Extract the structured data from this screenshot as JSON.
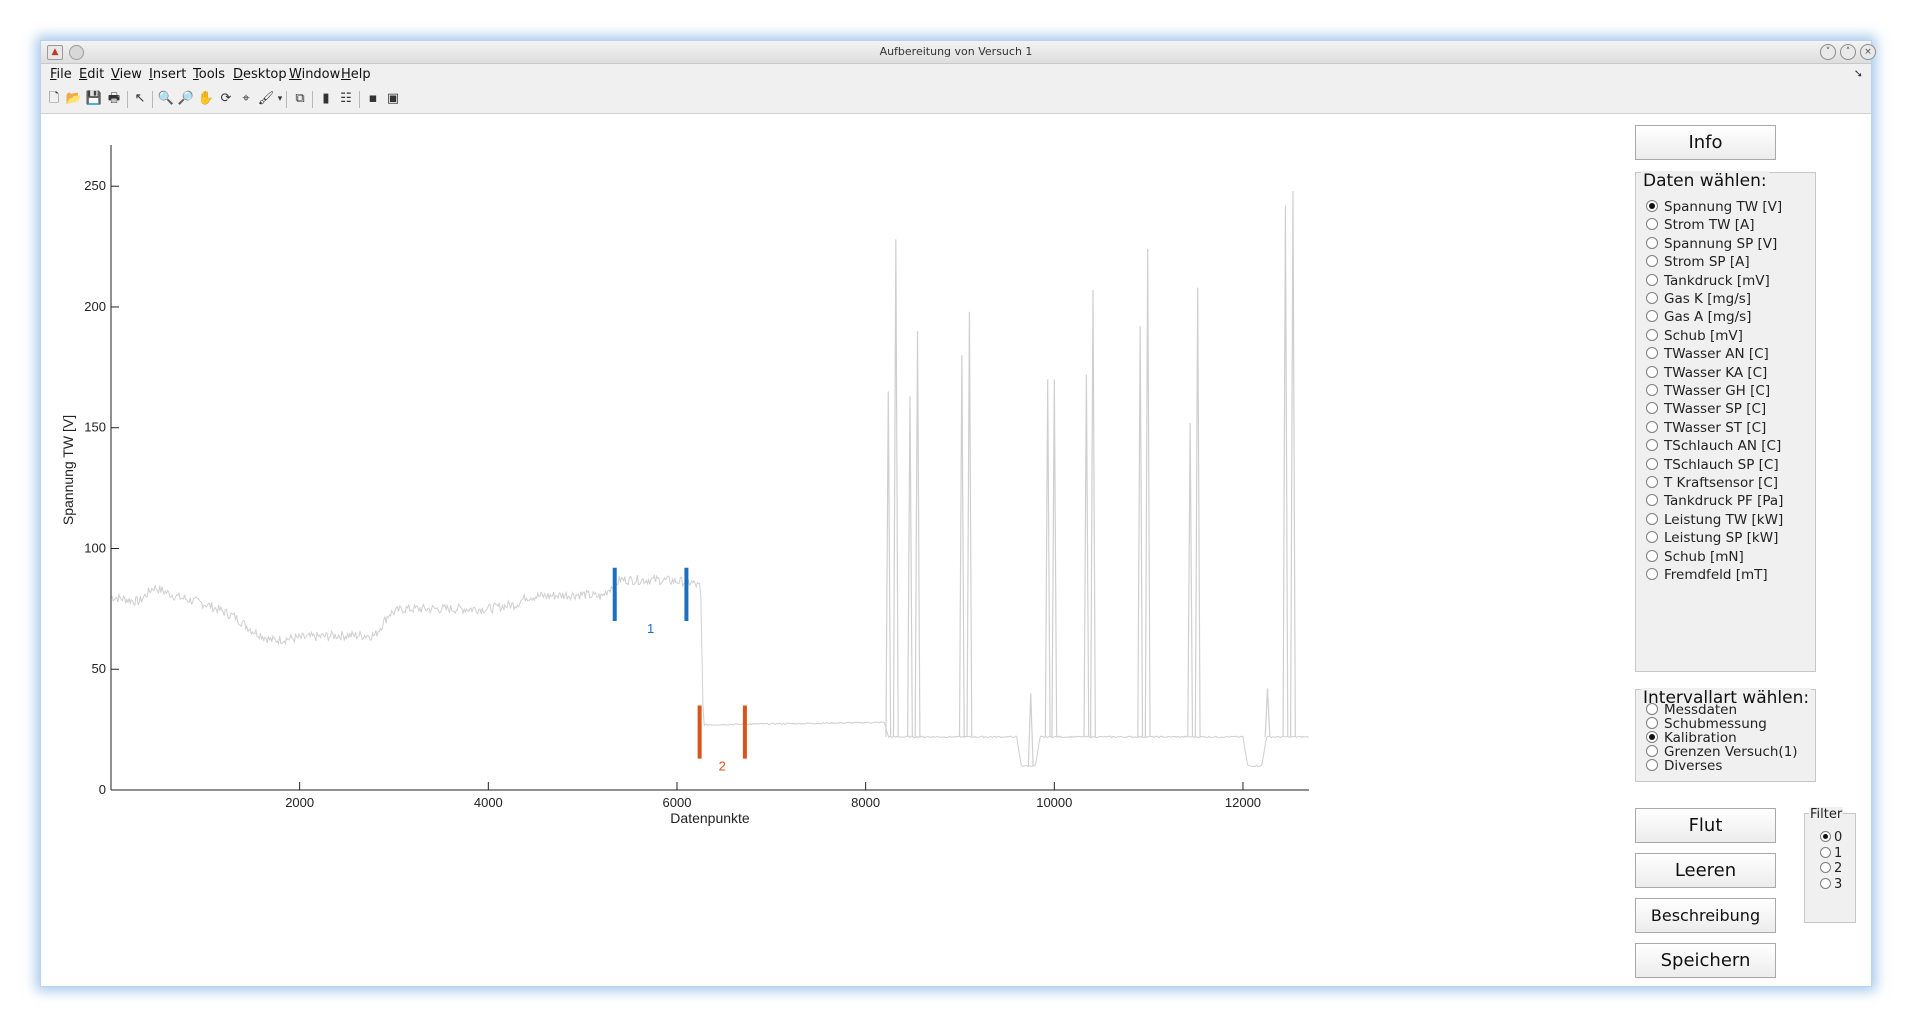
{
  "window": {
    "title": "Aufbereitung von Versuch 1"
  },
  "menu": [
    "File",
    "Edit",
    "View",
    "Insert",
    "Tools",
    "Desktop",
    "Window",
    "Help"
  ],
  "toolbar_icons": [
    "new-figure-icon",
    "open-file-icon",
    "save-icon",
    "print-icon",
    "pointer-icon",
    "zoom-in-icon",
    "zoom-out-icon",
    "pan-icon",
    "rotate-3d-icon",
    "data-cursor-icon",
    "brush-icon",
    "link-plot-icon",
    "colorbar-icon",
    "legend-icon",
    "hide-plot-tools-icon",
    "show-plot-tools-icon"
  ],
  "buttons": {
    "info": "Info",
    "flut": "Flut",
    "leeren": "Leeren",
    "beschreibung": "Beschreibung",
    "speichern": "Speichern"
  },
  "daten_panel": {
    "title": "Daten wählen:",
    "options": [
      "Spannung TW [V]",
      "Strom TW [A]",
      "Spannung SP [V]",
      "Strom SP [A]",
      "Tankdruck [mV]",
      "Gas K [mg/s]",
      "Gas A [mg/s]",
      "Schub [mV]",
      "TWasser AN [C]",
      "TWasser KA [C]",
      "TWasser GH [C]",
      "TWasser SP [C]",
      "TWasser ST [C]",
      "TSchlauch AN [C]",
      "TSchlauch SP [C]",
      "T Kraftsensor [C]",
      "Tankdruck PF [Pa]",
      "Leistung TW [kW]",
      "Leistung SP [kW]",
      "Schub [mN]",
      "Fremdfeld [mT]"
    ],
    "selected": 0
  },
  "intervall_panel": {
    "title": "Intervallart wählen:",
    "options": [
      "Messdaten",
      "Schubmessung",
      "Kalibration",
      "Grenzen Versuch(1)",
      "Diverses"
    ],
    "selected": 2
  },
  "filter": {
    "title": "Filter",
    "options": [
      "0",
      "1",
      "2",
      "3"
    ],
    "selected": 0
  },
  "chart_data": {
    "type": "line",
    "xlabel": "Datenpunkte",
    "ylabel": "Spannung TW [V]",
    "xlim": [
      0,
      12700
    ],
    "ylim": [
      0,
      265
    ],
    "xticks": [
      2000,
      4000,
      6000,
      8000,
      10000,
      12000
    ],
    "yticks": [
      0,
      50,
      100,
      150,
      200,
      250
    ],
    "series_color": "#cfcfcf",
    "baseline": [
      [
        0,
        80
      ],
      [
        300,
        78
      ],
      [
        450,
        84
      ],
      [
        700,
        80
      ],
      [
        1000,
        77
      ],
      [
        1300,
        72
      ],
      [
        1500,
        66
      ],
      [
        1700,
        62
      ],
      [
        2000,
        63
      ],
      [
        2400,
        64
      ],
      [
        2800,
        64
      ],
      [
        2950,
        73
      ],
      [
        3100,
        75
      ],
      [
        3500,
        75
      ],
      [
        4000,
        75
      ],
      [
        4300,
        77
      ],
      [
        4400,
        80
      ],
      [
        5000,
        81
      ],
      [
        5200,
        80
      ],
      [
        5300,
        84
      ],
      [
        5400,
        87
      ],
      [
        5800,
        87
      ],
      [
        6150,
        86
      ],
      [
        6250,
        84
      ],
      [
        6280,
        27
      ],
      [
        8200,
        28
      ],
      [
        8240,
        22
      ],
      [
        9600,
        22
      ],
      [
        9650,
        10
      ],
      [
        9800,
        10
      ],
      [
        9850,
        22
      ],
      [
        12000,
        22
      ],
      [
        12050,
        10
      ],
      [
        12200,
        10
      ],
      [
        12250,
        22
      ],
      [
        12700,
        22
      ]
    ],
    "spikes": [
      [
        8240,
        165
      ],
      [
        8320,
        228
      ],
      [
        8470,
        163
      ],
      [
        8550,
        190
      ],
      [
        9020,
        180
      ],
      [
        9100,
        198
      ],
      [
        9750,
        40
      ],
      [
        9930,
        170
      ],
      [
        10000,
        170
      ],
      [
        10340,
        172
      ],
      [
        10410,
        207
      ],
      [
        10910,
        192
      ],
      [
        10990,
        224
      ],
      [
        11440,
        152
      ],
      [
        11520,
        208
      ],
      [
        12260,
        42
      ],
      [
        12450,
        242
      ],
      [
        12530,
        248
      ]
    ],
    "markers": [
      {
        "label": "1",
        "color": "#1f6fbf",
        "x": [
          5340,
          6100
        ],
        "y": [
          70,
          92
        ]
      },
      {
        "label": "2",
        "color": "#d9541a",
        "x": [
          6240,
          6720
        ],
        "y": [
          13,
          35
        ]
      }
    ]
  }
}
